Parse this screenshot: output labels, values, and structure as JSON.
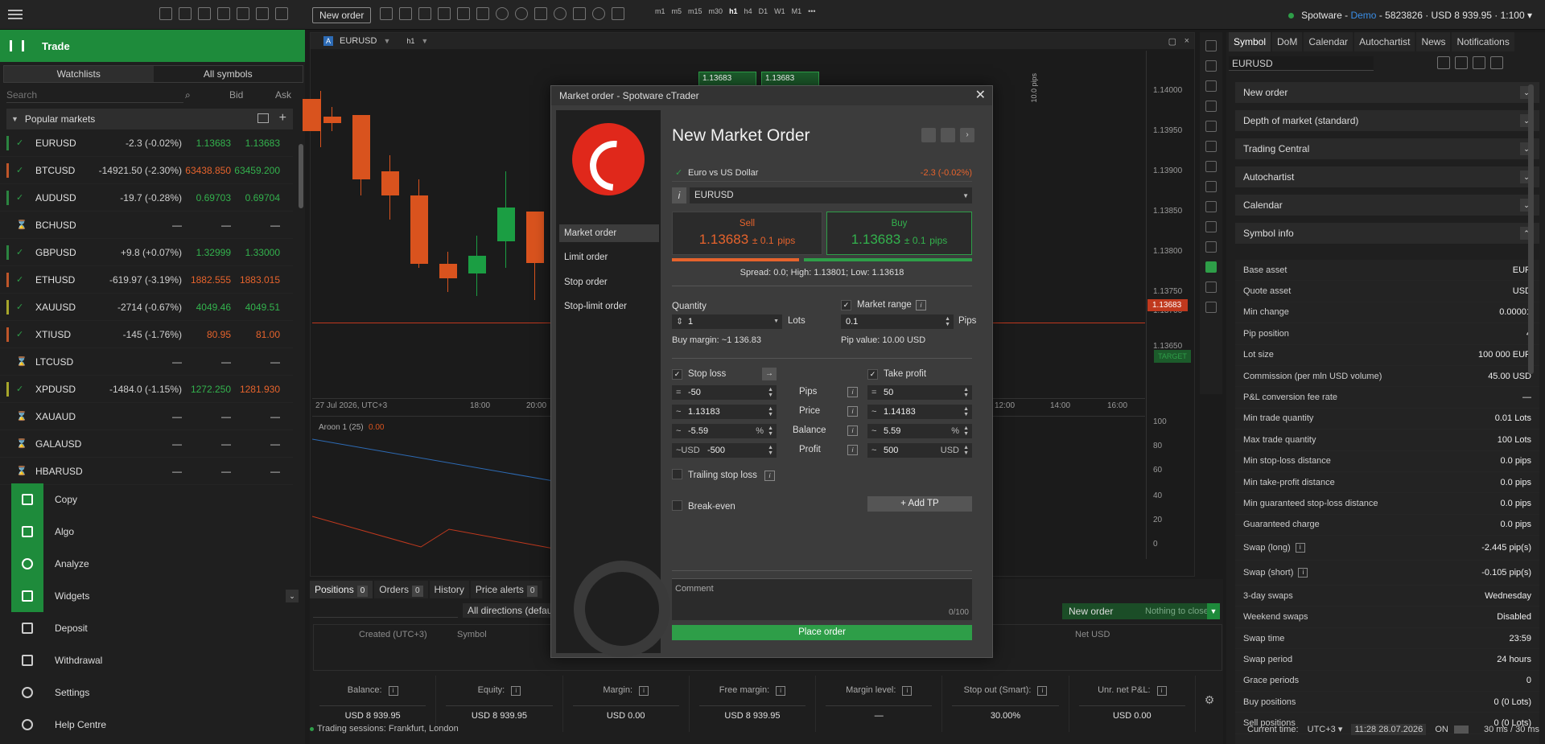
{
  "topbar": {
    "new_order": "New order",
    "timeframes": [
      "m1",
      "m5",
      "m15",
      "m30",
      "h1",
      "h4",
      "D1",
      "W1",
      "M1"
    ],
    "account": {
      "broker": "Spotware",
      "mode": "Demo",
      "id": "5823826",
      "balance": "USD 8 939.95",
      "leverage": "1:100"
    }
  },
  "left": {
    "section": "Trade",
    "tabs": [
      "Watchlists",
      "All symbols"
    ],
    "search_placeholder": "Search",
    "bid_header": "Bid",
    "ask_header": "Ask",
    "group": "Popular markets",
    "symbols": [
      {
        "name": "EURUSD",
        "change": "-2.3 (-0.02%)",
        "bid": "1.13683",
        "ask": "1.13683",
        "dir": "g"
      },
      {
        "name": "BTCUSD",
        "change": "-14921.50 (-2.30%)",
        "bid": "63438.850",
        "ask": "63459.200",
        "dir": "o"
      },
      {
        "name": "AUDUSD",
        "change": "-19.7 (-0.28%)",
        "bid": "0.69703",
        "ask": "0.69704",
        "dir": "g"
      },
      {
        "name": "BCHUSD",
        "change": "—",
        "bid": "—",
        "ask": "—",
        "dir": ""
      },
      {
        "name": "GBPUSD",
        "change": "+9.8 (+0.07%)",
        "bid": "1.32999",
        "ask": "1.33000",
        "dir": "g"
      },
      {
        "name": "ETHUSD",
        "change": "-619.97 (-3.19%)",
        "bid": "1882.555",
        "ask": "1883.015",
        "dir": "o"
      },
      {
        "name": "XAUUSD",
        "change": "-2714 (-0.67%)",
        "bid": "4049.46",
        "ask": "4049.51",
        "dir": "g"
      },
      {
        "name": "XTIUSD",
        "change": "-145 (-1.76%)",
        "bid": "80.95",
        "ask": "81.00",
        "dir": "o"
      },
      {
        "name": "LTCUSD",
        "change": "—",
        "bid": "—",
        "ask": "—",
        "dir": ""
      },
      {
        "name": "XPDUSD",
        "change": "-1484.0 (-1.15%)",
        "bid": "1272.250",
        "ask": "1281.930",
        "dir": "g"
      },
      {
        "name": "XAUAUD",
        "change": "—",
        "bid": "—",
        "ask": "—",
        "dir": ""
      },
      {
        "name": "GALAUSD",
        "change": "—",
        "bid": "—",
        "ask": "—",
        "dir": ""
      },
      {
        "name": "HBARUSD",
        "change": "—",
        "bid": "—",
        "ask": "—",
        "dir": ""
      }
    ],
    "nav": [
      "Copy",
      "Algo",
      "Analyze",
      "Widgets",
      "Deposit",
      "Withdrawal",
      "Settings",
      "Help Centre"
    ]
  },
  "chart": {
    "symbol": "EURUSD",
    "timeframe": "h1",
    "prices": [
      "1.14000",
      "1.13950",
      "1.13900",
      "1.13850",
      "1.13800",
      "1.13750",
      "1.13700",
      "1.13650"
    ],
    "current_price": "1.13683",
    "pip_scale": "10.0 pips",
    "quick_sell": "1.13683",
    "quick_buy": "1.13683",
    "times": [
      "27 Jul 2026, UTC+3",
      "18:00",
      "20:00",
      "12:00",
      "14:00",
      "16:00"
    ],
    "oscillator": "Aroon 1 (25)",
    "osc_value": "0.00",
    "osc_levels": [
      "100",
      "80",
      "60",
      "40",
      "20",
      "0"
    ],
    "target": "TARGET"
  },
  "bottom": {
    "tabs": [
      {
        "label": "Positions",
        "count": "0"
      },
      {
        "label": "Orders",
        "count": "0"
      },
      {
        "label": "History"
      },
      {
        "label": "Price alerts",
        "count": "0"
      }
    ],
    "directions": "All directions (default)",
    "new_order": "New order",
    "nothing_to_close": "Nothing to close",
    "columns": [
      "Created (UTC+3)",
      "Symbol",
      "Net USD"
    ],
    "summary": [
      {
        "label": "Balance:",
        "value": "USD 8 939.95"
      },
      {
        "label": "Equity:",
        "value": "USD 8 939.95"
      },
      {
        "label": "Margin:",
        "value": "USD 0.00"
      },
      {
        "label": "Free margin:",
        "value": "USD 8 939.95"
      },
      {
        "label": "Margin level:",
        "value": "—"
      },
      {
        "label": "Stop out (Smart):",
        "value": "30.00%"
      },
      {
        "label": "Unr. net P&L:",
        "value": "USD 0.00"
      }
    ],
    "sessions": "Trading sessions: Frankfurt, London"
  },
  "right": {
    "tabs": [
      "Symbol",
      "DoM",
      "Calendar",
      "Autochartist",
      "News",
      "Notifications"
    ],
    "symbol": "EURUSD",
    "accordions": [
      "New order",
      "Depth of market (standard)",
      "Trading Central",
      "Autochartist",
      "Calendar",
      "Symbol info"
    ],
    "info": [
      {
        "k": "Base asset",
        "v": "EUR"
      },
      {
        "k": "Quote asset",
        "v": "USD"
      },
      {
        "k": "Min change",
        "v": "0.00001"
      },
      {
        "k": "Pip position",
        "v": "4"
      },
      {
        "k": "Lot size",
        "v": "100 000 EUR"
      },
      {
        "k": "Commission (per mln USD volume)",
        "v": "45.00 USD"
      },
      {
        "k": "P&L conversion fee rate",
        "v": "—"
      },
      {
        "k": "Min trade quantity",
        "v": "0.01 Lots"
      },
      {
        "k": "Max trade quantity",
        "v": "100 Lots"
      },
      {
        "k": "Min stop-loss distance",
        "v": "0.0 pips"
      },
      {
        "k": "Min take-profit distance",
        "v": "0.0 pips"
      },
      {
        "k": "Min guaranteed stop-loss distance",
        "v": "0.0 pips"
      },
      {
        "k": "Guaranteed charge",
        "v": "0.0 pips"
      },
      {
        "k": "Swap (long)",
        "v": "-2.445 pip(s)"
      },
      {
        "k": "Swap (short)",
        "v": "-0.105 pip(s)"
      },
      {
        "k": "3-day swaps",
        "v": "Wednesday"
      },
      {
        "k": "Weekend swaps",
        "v": "Disabled"
      },
      {
        "k": "Swap time",
        "v": "23:59"
      },
      {
        "k": "Swap period",
        "v": "24 hours"
      },
      {
        "k": "Grace periods",
        "v": "0"
      },
      {
        "k": "Buy positions",
        "v": "0 (0 Lots)"
      },
      {
        "k": "Sell positions",
        "v": "0 (0 Lots)"
      }
    ],
    "status": {
      "label": "Current time:",
      "tz": "UTC+3",
      "time": "11:28 28.07.2026",
      "on": "ON",
      "latency": "30 ms / 30 ms"
    }
  },
  "modal": {
    "title": "Market order - Spotware cTrader",
    "heading": "New Market Order",
    "order_types": [
      "Market order",
      "Limit order",
      "Stop order",
      "Stop-limit order"
    ],
    "desc": "Euro vs US Dollar",
    "change": "-2.3 (-0.02%)",
    "symbol": "EURUSD",
    "sell": {
      "label": "Sell",
      "price": "1.13683",
      "spread": "± 0.1",
      "unit": "pips"
    },
    "buy": {
      "label": "Buy",
      "price": "1.13683",
      "spread": "± 0.1",
      "unit": "pips"
    },
    "spread_info": "Spread: 0.0; High: 1.13801; Low: 1.13618",
    "quantity_label": "Quantity",
    "quantity": "1",
    "lots": "Lots",
    "buy_margin": "Buy margin: ~1 136.83",
    "market_range_label": "Market range",
    "market_range": "0.1",
    "pips": "Pips",
    "pip_value": "Pip value: 10.00 USD",
    "stop_loss_label": "Stop loss",
    "take_profit_label": "Take profit",
    "sl": {
      "pips": "-50",
      "price": "1.13183",
      "balance": "-5.59",
      "profit": "-500"
    },
    "tp": {
      "pips": "50",
      "price": "1.14183",
      "balance": "5.59",
      "profit": "500"
    },
    "row_labels": [
      "Pips",
      "Price",
      "Balance",
      "Profit"
    ],
    "ccy": "USD",
    "ccy_sl": "~USD",
    "pct": "%",
    "trailing": "Trailing stop loss",
    "add_tp": "+ Add TP",
    "break_even": "Break-even",
    "comment_placeholder": "Comment",
    "comment_count": "0/100",
    "place": "Place order"
  }
}
